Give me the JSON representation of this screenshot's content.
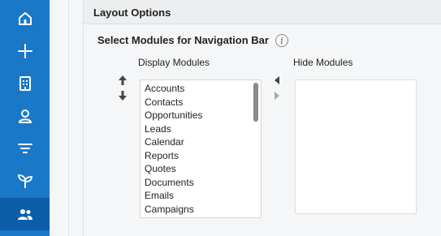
{
  "sidebar": {
    "items": [
      {
        "icon": "home-icon"
      },
      {
        "icon": "plus-icon"
      },
      {
        "icon": "building-icon"
      },
      {
        "icon": "user-icon"
      },
      {
        "icon": "filter-icon"
      },
      {
        "icon": "sprout-icon"
      },
      {
        "icon": "users-icon",
        "active": true
      }
    ]
  },
  "section": {
    "title": "Layout Options"
  },
  "modules": {
    "subtitle": "Select Modules for Navigation Bar",
    "info_glyph": "i",
    "display_label": "Display Modules",
    "hide_label": "Hide Modules",
    "display_list": [
      "Accounts",
      "Contacts",
      "Opportunities",
      "Leads",
      "Calendar",
      "Reports",
      "Quotes",
      "Documents",
      "Emails",
      "Campaigns"
    ],
    "hide_list": []
  },
  "colors": {
    "sidebar": "#1a78c9",
    "sidebar_active": "#0d5ea8"
  }
}
